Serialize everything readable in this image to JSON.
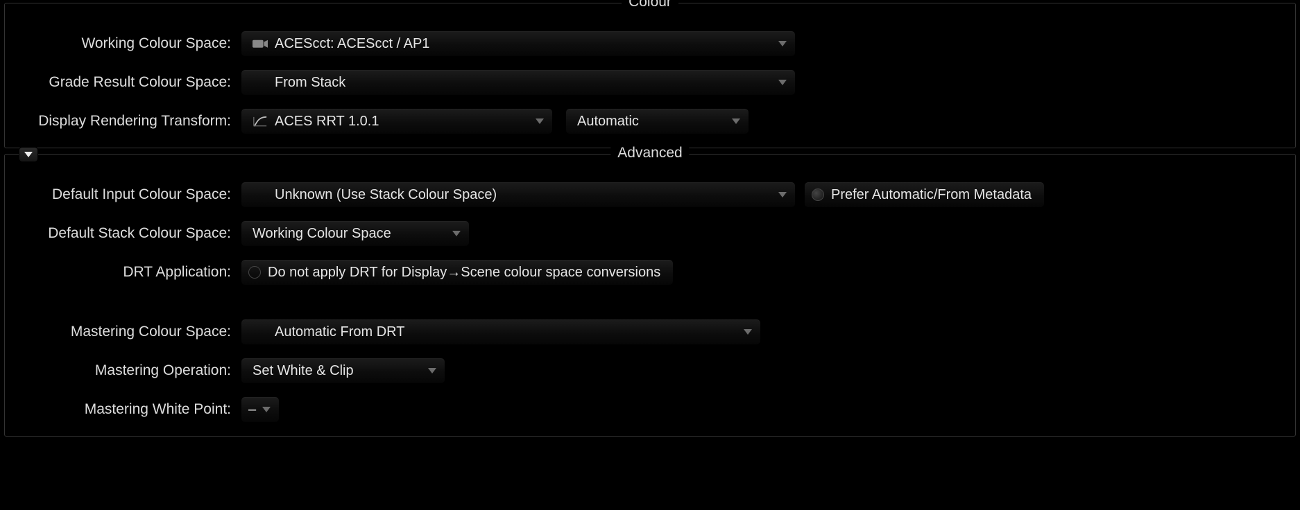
{
  "colour_section": {
    "legend": "Colour",
    "working_colour_space_label": "Working Colour Space:",
    "working_colour_space_value": "ACEScct: ACEScct / AP1",
    "grade_result_label": "Grade Result Colour Space:",
    "grade_result_value": "From Stack",
    "drt_label": "Display Rendering Transform:",
    "drt_value": "ACES RRT 1.0.1",
    "drt_mode_value": "Automatic"
  },
  "advanced_section": {
    "legend": "Advanced",
    "default_input_label": "Default Input Colour Space:",
    "default_input_value": "Unknown (Use Stack Colour Space)",
    "prefer_auto_label": "Prefer Automatic/From Metadata",
    "default_stack_label": "Default Stack Colour Space:",
    "default_stack_value": "Working Colour Space",
    "drt_application_label": "DRT Application:",
    "drt_application_value": "Do not apply DRT for Display→Scene colour space conversions",
    "mastering_colour_space_label": "Mastering Colour Space:",
    "mastering_colour_space_value": "Automatic From DRT",
    "mastering_operation_label": "Mastering Operation:",
    "mastering_operation_value": "Set White & Clip",
    "mastering_white_point_label": "Mastering White Point:",
    "mastering_white_point_value": "–"
  }
}
